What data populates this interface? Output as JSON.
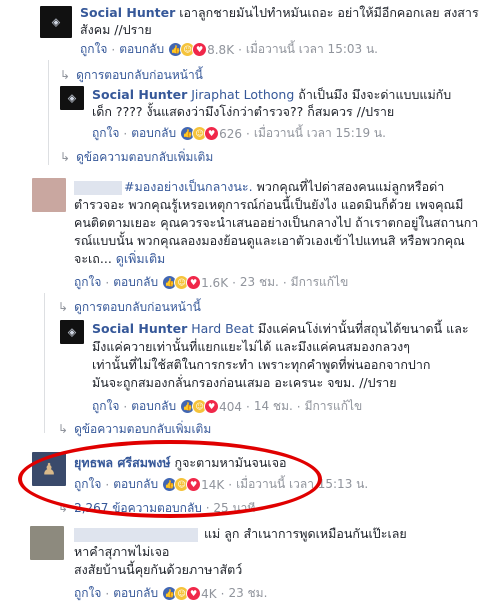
{
  "comment1": {
    "author": "Social Hunter",
    "text_line1": "เอาลูกชายมันไปทำหมันเถอะ อย่าให้มีอีกคอกเลย สงสาร",
    "text_line2": "สังคม //ปราย",
    "like": "ถูกใจ",
    "reply": "ตอบกลับ",
    "count": "8.8K",
    "time": "เมื่อวานนี้ เวลา 15:03 น."
  },
  "prev_replies_1": "ดูการตอบกลับก่อนหน้านี้",
  "reply1": {
    "author": "Social Hunter",
    "tag": "Jiraphat Lothong",
    "text_line1": "ถ้าเป็นมึง มึงจะด่าแบบแม่กับ",
    "text_line2": "เด็ก ???? งั้นแสดงว่ามึงโง่กว่าตำรวจ?? ก็สมควร //ปราย",
    "like": "ถูกใจ",
    "reply": "ตอบกลับ",
    "count": "626",
    "time": "เมื่อวานนี้ เวลา 15:19 น."
  },
  "more_replies_1": "ดูข้อความตอบกลับเพิ่มเติม",
  "comment2": {
    "hashtag": "#มองอย่างเป็นกลางนะ.",
    "text_line1": " พวกคุณที่ไปด่าสองคนแม่ลูกหรือด่า",
    "text_line2": "ตำรวจอะ พวกคุณรู้เหรอเหตุการณ์ก่อนนี้เป็นยังไง แอดมินก็ด้วย เพจคุณมี",
    "text_line3": "คนติดตามเยอะ คุณควรจะนำเสนออย่างเป็นกลางไป ถ้าเราตกอยู่ในสถานกา",
    "text_line4": "รณ์แบบนั้น พวกคุณลองมองย้อนดูและเอาตัวเองเข้าไปแทนสิ หรือพวกคุณ",
    "text_line5": "จะเถ...",
    "see_more": "ดูเพิ่มเติม",
    "like": "ถูกใจ",
    "reply": "ตอบกลับ",
    "count": "1.6K",
    "time": "23 ชม.",
    "edited": "มีการแก้ไข"
  },
  "prev_replies_2": "ดูการตอบกลับก่อนหน้านี้",
  "reply2": {
    "author": "Social Hunter",
    "tag": "Hard Beat",
    "text_line1": "มึงแค่คนโง่เท่านั้นที่สถุนได้ขนาดนี้ และ",
    "text_line2": "มึงแค่ควายเท่านั้นที่แยกแยะไม่ได้ และมึงแค่คนสมองกลวงๆ",
    "text_line3": "เท่านั้นที่ไม่ใช้สติในการกระทำ เพราะทุกคำพูดที่พ่นออกจากปาก",
    "text_line4": "มันจะถูกสมองกลั่นกรองก่อนเสมอ อะเครนะ จขม. //ปราย",
    "like": "ถูกใจ",
    "reply": "ตอบกลับ",
    "count": "404",
    "time": "14 ชม.",
    "edited": "มีการแก้ไข"
  },
  "more_replies_2": "ดูข้อความตอบกลับเพิ่มเติม",
  "comment3": {
    "author": "ยุทธพล ศรีสมพงษ์",
    "text": "กูจะตามหามันจนเจอ",
    "like": "ถูกใจ",
    "reply": "ตอบกลับ",
    "count": "14K",
    "time": "เมื่อวานนี้ เวลา 15:13 น.",
    "replies_link": "2,267 ข้อความตอบกลับ",
    "replies_time": "25 นาที"
  },
  "comment4": {
    "text_line1": "แม่ ลูก สำเนาการพูดเหมือนกันเป๊ะเลย",
    "text_line2": "หาคำสุภาพไม่เจอ",
    "text_line3": "สงสัยบ้านนี้คุยกันด้วยภาษาสัตว์",
    "like": "ถูกใจ",
    "reply": "ตอบกลับ",
    "count": "4K",
    "time": "23 ชม."
  },
  "colors": {
    "link": "#365899",
    "muted": "#90949c",
    "highlight": "#e00000"
  }
}
